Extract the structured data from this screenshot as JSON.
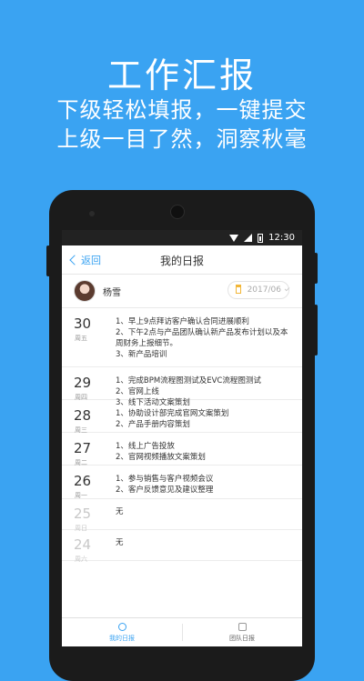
{
  "hero": {
    "title": "工作汇报",
    "line1": "下级轻松填报，一键提交",
    "line2": "上级一目了然，洞察秋毫"
  },
  "status_bar": {
    "time": "12:30",
    "icons": [
      "wifi-icon",
      "signal-icon",
      "battery-icon"
    ]
  },
  "nav": {
    "back_label": "返回",
    "title": "我的日报"
  },
  "user": {
    "name": "杨雪",
    "month": "2017/06"
  },
  "reports": [
    {
      "day": "30",
      "weekday": "周五",
      "items": [
        "1、早上9点拜访客户确认合同进展顺利",
        "2、下午2点与产品团队确认新产品发布计划以及本周财务上报细节。",
        "3、新产品培训"
      ]
    },
    {
      "day": "29",
      "weekday": "周四",
      "items": [
        "1、完成BPM流程图测试及EVC流程图测试",
        "2、官网上线",
        "3、线下活动文案策划"
      ]
    },
    {
      "day": "28",
      "weekday": "周三",
      "items": [
        "1、协助设计部完成官网文案策划",
        "2、产品手册内容策划"
      ]
    },
    {
      "day": "27",
      "weekday": "周二",
      "items": [
        "1、线上广告投放",
        "2、官网视频播放文案策划"
      ]
    },
    {
      "day": "26",
      "weekday": "周一",
      "items": [
        "1、参与销售与客户视频会议",
        "2、客户反馈意见及建议整理"
      ]
    },
    {
      "day": "25",
      "weekday": "周日",
      "items": [
        "无"
      ]
    },
    {
      "day": "24",
      "weekday": "周六",
      "items": [
        "无"
      ]
    }
  ],
  "tabs": [
    {
      "label": "我的日报",
      "active": true
    },
    {
      "label": "团队日报",
      "active": false
    }
  ],
  "colors": {
    "background": "#3aa3f2",
    "accent": "#3aa3f2"
  }
}
